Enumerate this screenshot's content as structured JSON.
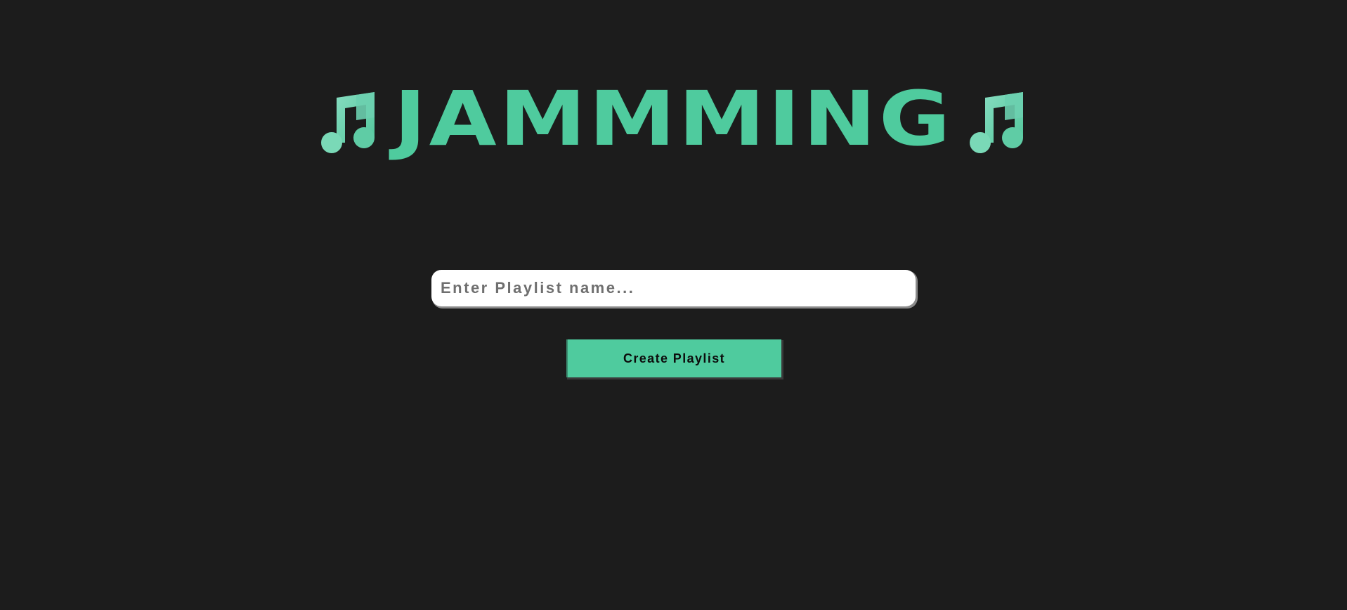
{
  "header": {
    "title": "JAMMMING",
    "left_icon": "music-note-icon",
    "right_icon": "music-note-icon"
  },
  "form": {
    "playlist_name": {
      "value": "",
      "placeholder": "Enter Playlist name..."
    },
    "create_button_label": "Create Playlist"
  },
  "colors": {
    "background": "#1c1c1c",
    "accent": "#4fcb9e",
    "accent_light": "#7ad9b7",
    "input_background": "#ffffff",
    "button_text": "#0c0c0c"
  }
}
